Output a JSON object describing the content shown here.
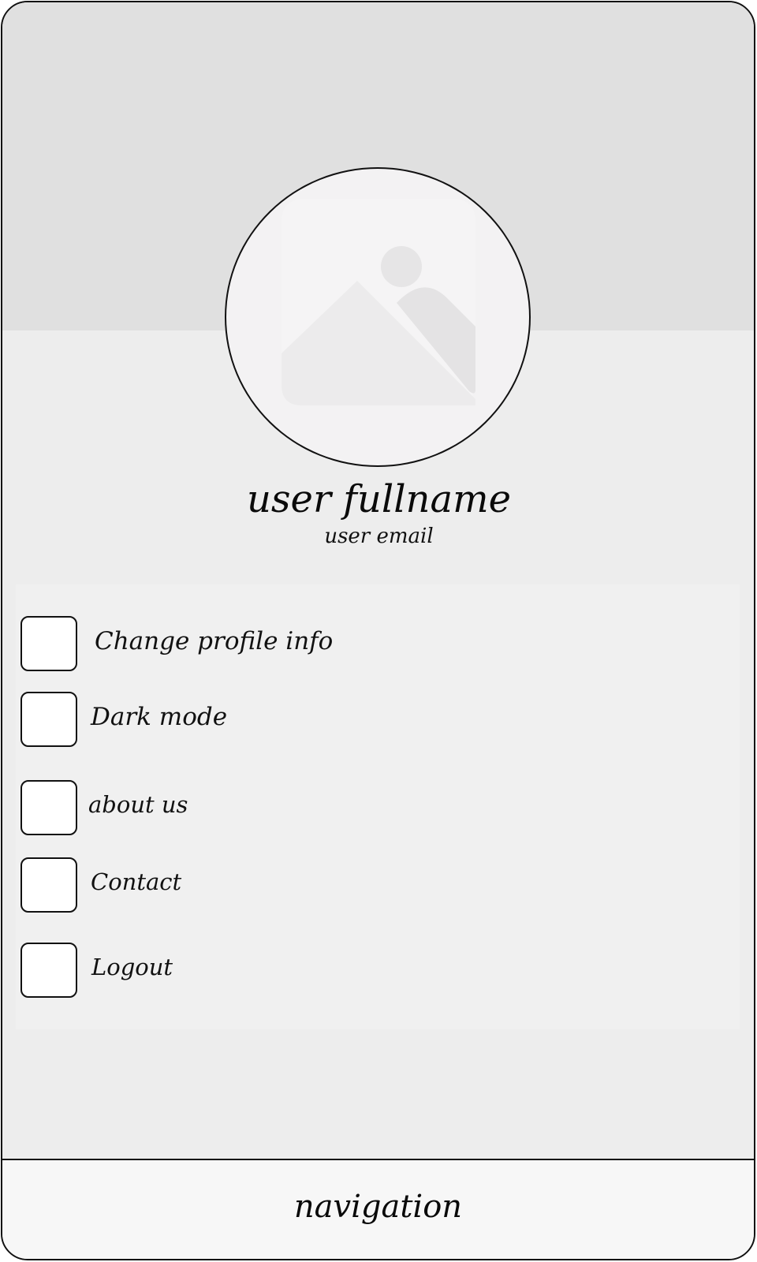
{
  "profile": {
    "avatar_icon": "image-placeholder-icon",
    "fullname": "user fullname",
    "email": "user email"
  },
  "menu": {
    "items": [
      {
        "label": "Change profile info",
        "icon": "profile-edit-icon"
      },
      {
        "label": "Dark mode",
        "icon": "dark-mode-icon"
      },
      {
        "label": "about us",
        "icon": "info-icon"
      },
      {
        "label": "Contact",
        "icon": "contact-icon"
      },
      {
        "label": "Logout",
        "icon": "logout-icon"
      }
    ]
  },
  "navigation": {
    "label": "navigation"
  },
  "colors": {
    "header_band": "#e0e0e0",
    "screen_background": "#ededed",
    "menu_background": "#f0f0f0",
    "nav_background": "#f7f7f7",
    "outline": "#111111"
  }
}
